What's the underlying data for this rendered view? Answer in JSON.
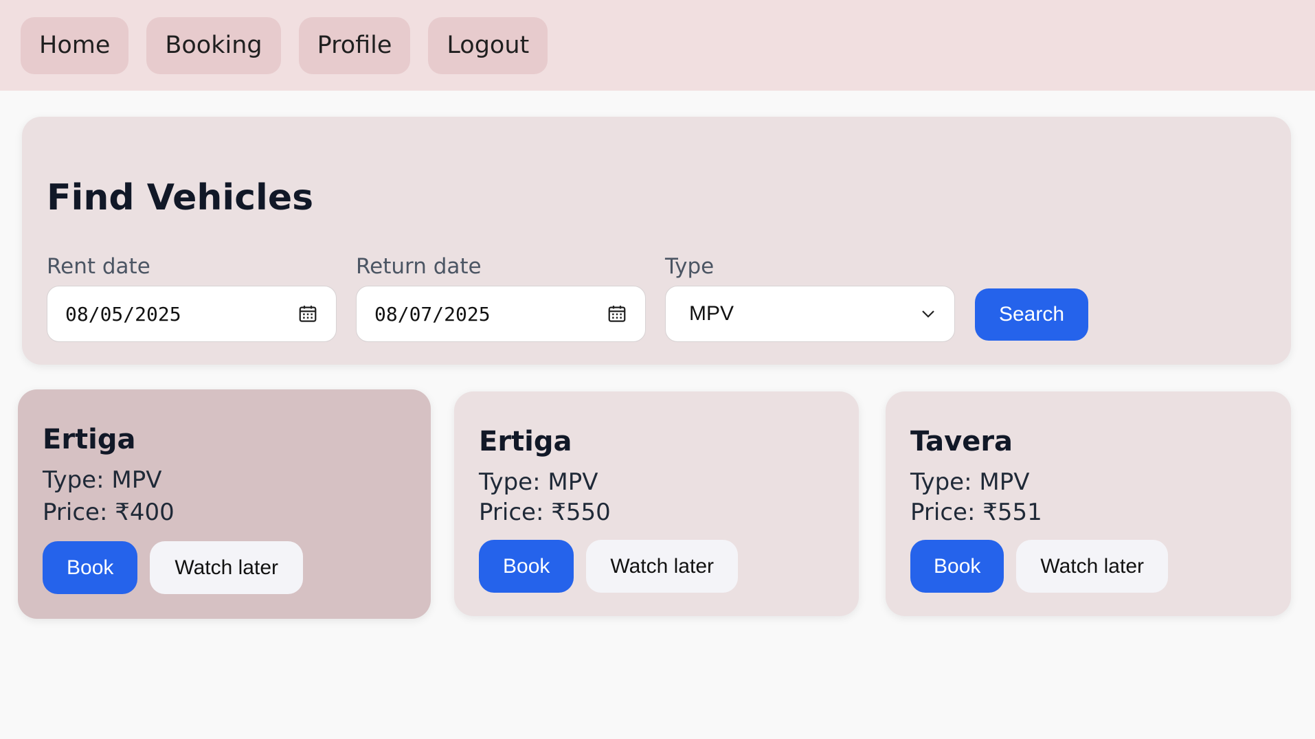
{
  "nav": {
    "items": [
      {
        "label": "Home"
      },
      {
        "label": "Booking"
      },
      {
        "label": "Profile"
      },
      {
        "label": "Logout"
      }
    ]
  },
  "search": {
    "title": "Find Vehicles",
    "rent_label": "Rent date",
    "rent_value": "08/05/2025",
    "return_label": "Return date",
    "return_value": "08/07/2025",
    "type_label": "Type",
    "type_value": "MPV",
    "button": "Search"
  },
  "vehicles": [
    {
      "name": "Ertiga",
      "type": "Type: MPV",
      "price": "Price: ₹400",
      "book": "Book",
      "watch": "Watch later"
    },
    {
      "name": "Ertiga",
      "type": "Type: MPV",
      "price": "Price: ₹550",
      "book": "Book",
      "watch": "Watch later"
    },
    {
      "name": "Tavera",
      "type": "Type: MPV",
      "price": "Price: ₹551",
      "book": "Book",
      "watch": "Watch later"
    }
  ],
  "colors": {
    "accent": "#2563eb",
    "navbar_bg": "#f1dfe0",
    "card_bg": "#ebe0e1",
    "card_hover_bg": "#d6c1c3"
  }
}
